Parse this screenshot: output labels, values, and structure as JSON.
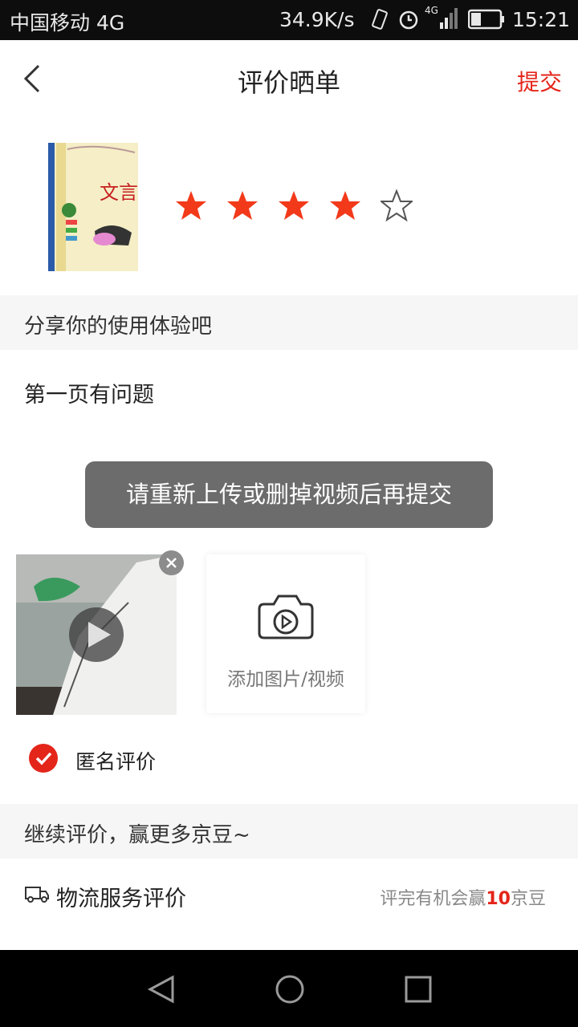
{
  "status_bar": {
    "carrier": "中国移动 4G",
    "speed": "34.9K/s",
    "network_badge": "4G",
    "time": "15:21"
  },
  "header": {
    "title": "评价晒单",
    "submit_label": "提交"
  },
  "product": {
    "cover_text": "文言文",
    "rating": 4,
    "max_rating": 5,
    "star_color": "#f23a1a"
  },
  "experience_section": {
    "heading": "分享你的使用体验吧"
  },
  "review": {
    "text": "第一页有问题"
  },
  "toast": {
    "message": "请重新上传或删掉视频后再提交"
  },
  "media": {
    "add_label": "添加图片/视频"
  },
  "anonymous": {
    "label": "匿名评价",
    "checked": true
  },
  "continue_section": {
    "heading": "继续评价，赢更多京豆~"
  },
  "logistics": {
    "label": "物流服务评价",
    "hint_prefix": "评完有机会赢",
    "hint_number": "10",
    "hint_suffix": "京豆"
  },
  "colors": {
    "accent": "#e4251a",
    "section_bg": "#f6f6f6",
    "toast_bg": "#646464"
  }
}
